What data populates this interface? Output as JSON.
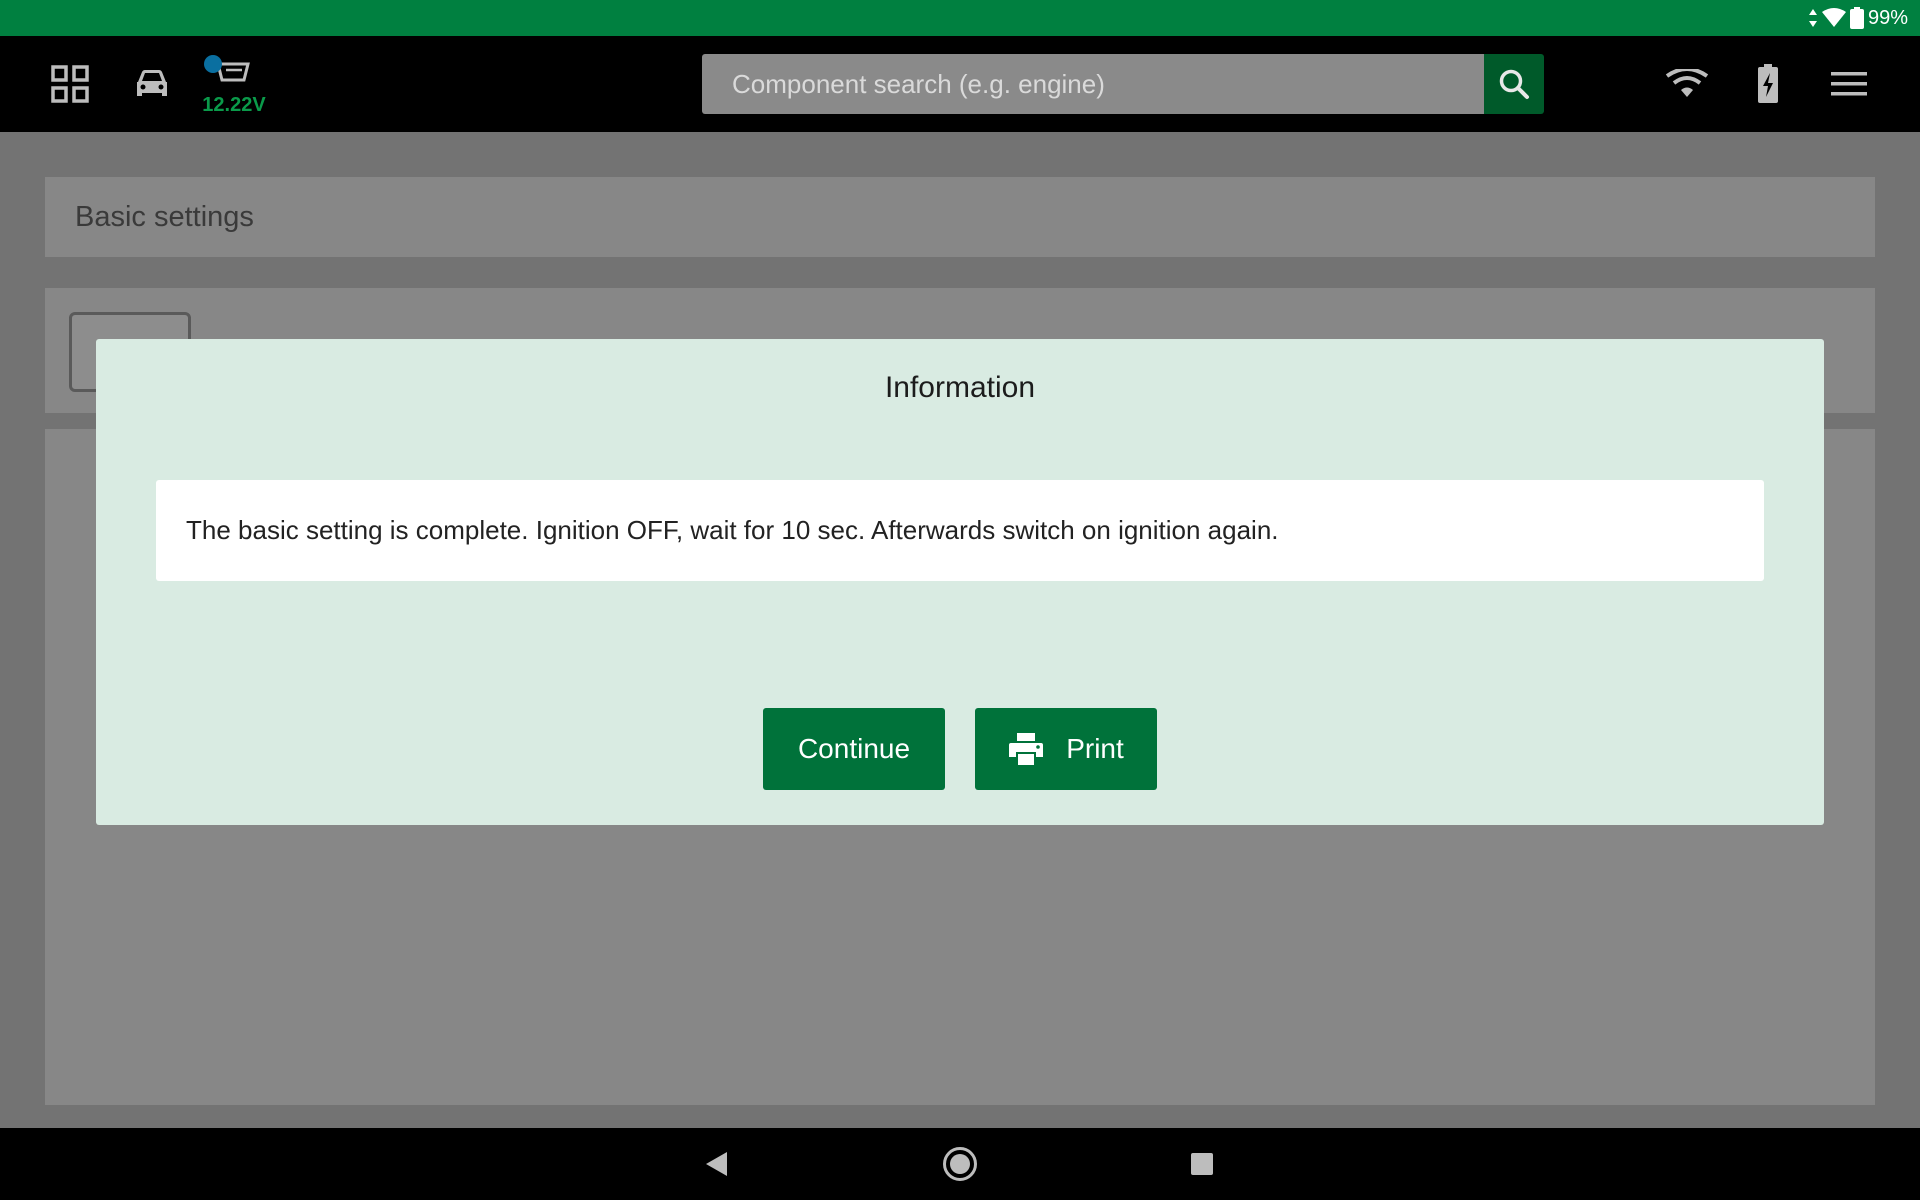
{
  "status_bar": {
    "battery_text": "99%",
    "icons": [
      "data-arrows-icon",
      "wifi-icon",
      "battery-icon"
    ]
  },
  "toolbar": {
    "voltage": "12.22V",
    "search": {
      "placeholder": "Component search (e.g. engine)",
      "value": ""
    },
    "icons": [
      "grid-menu-icon",
      "car-icon",
      "obd-connector-icon",
      "search-icon",
      "wifi-icon",
      "battery-charging-icon",
      "hamburger-menu-icon"
    ]
  },
  "page": {
    "title": "Basic settings"
  },
  "dialog": {
    "title": "Information",
    "message": "The basic setting is complete. Ignition OFF, wait for 10 sec. Afterwards switch on ignition again.",
    "buttons": {
      "continue_label": "Continue",
      "print_label": "Print"
    }
  },
  "nav_bar": {
    "icons": [
      "back-icon",
      "home-icon",
      "recents-icon"
    ]
  },
  "colors": {
    "status_bar": "#008040",
    "accent_green": "#00723a",
    "dialog_bg": "#d9ebe2",
    "voltage_text": "#0a9a4a"
  }
}
